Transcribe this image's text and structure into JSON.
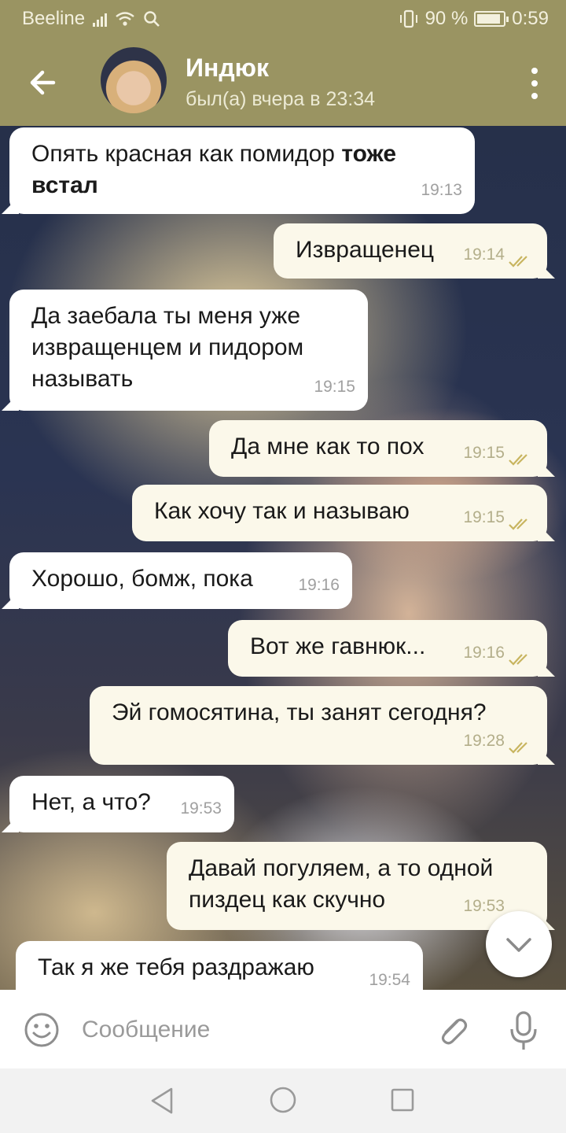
{
  "status_bar": {
    "carrier": "Beeline",
    "battery_percent": "90 %",
    "battery_level": 0.9,
    "time": "0:59"
  },
  "header": {
    "back_icon": "arrow-left-icon",
    "contact_name": "Индюк",
    "last_seen": "был(а) вчера в 23:34",
    "menu_icon": "vertical-dots-icon"
  },
  "messages": [
    {
      "direction": "in",
      "text_prefix": "Опять красная как помидор ",
      "text_bold": "тоже встал",
      "time": "19:13"
    },
    {
      "direction": "out",
      "text": "Извращенец",
      "time": "19:14",
      "read": true
    },
    {
      "direction": "in",
      "text": "Да заебала ты меня уже извращенцем и пидором называть",
      "time": "19:15"
    },
    {
      "direction": "out",
      "text": "Да мне как то пох",
      "time": "19:15",
      "read": true
    },
    {
      "direction": "out",
      "text": "Как хочу так и называю",
      "time": "19:15",
      "read": true
    },
    {
      "direction": "in",
      "text": "Хорошо, бомж, пока",
      "time": "19:16"
    },
    {
      "direction": "out",
      "text": "Вот же гавнюк...",
      "time": "19:16",
      "read": true
    },
    {
      "direction": "out",
      "text": "Эй гомосятина, ты занят сегодня?",
      "time": "19:28",
      "read": true
    },
    {
      "direction": "in",
      "text": "Нет, а что?",
      "time": "19:53"
    },
    {
      "direction": "out",
      "text": "Давай погуляем, а то одной пиздец как скучно",
      "time": "19:53",
      "read": true
    },
    {
      "direction": "in",
      "text": "Так я же тебя раздражаю",
      "time": "19:54"
    }
  ],
  "input": {
    "placeholder": "Сообщение",
    "emoji_icon": "smile-icon",
    "attach_icon": "paperclip-icon",
    "mic_icon": "microphone-icon"
  },
  "colors": {
    "header": "#9a9462",
    "incoming_bubble": "#ffffff",
    "outgoing_bubble": "#fbf8ea",
    "read_check": "#c8b560"
  }
}
